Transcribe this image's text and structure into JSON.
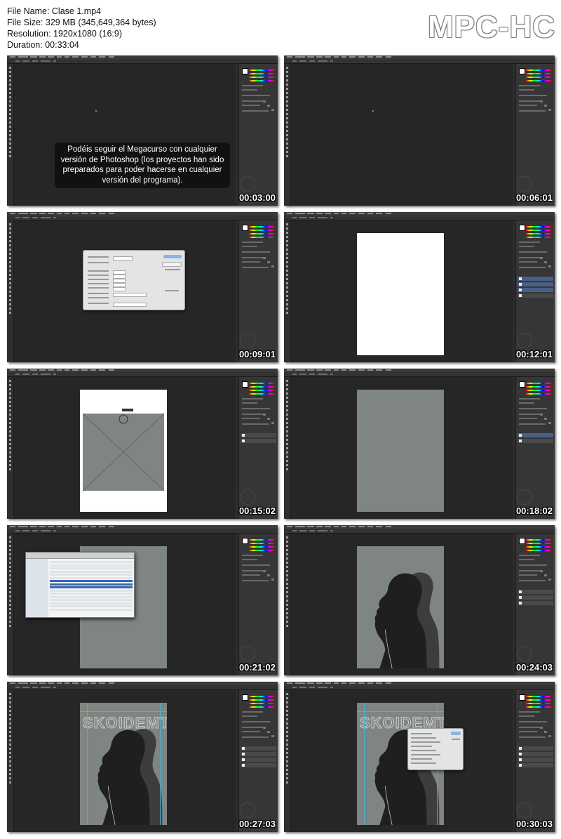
{
  "file_info": {
    "file_name": "File Name: Clase 1.mp4",
    "file_size": "File Size: 329 MB (345,649,364 bytes)",
    "resolution": "Resolution: 1920x1080 (16:9)",
    "duration": "Duration: 00:33:04"
  },
  "brand": "MPC-HC",
  "thumbnails": [
    {
      "timecode": "00:03:00",
      "scene": "empty-with-caption"
    },
    {
      "timecode": "00:06:01",
      "scene": "empty"
    },
    {
      "timecode": "00:09:01",
      "scene": "new-document-dialog"
    },
    {
      "timecode": "00:12:01",
      "scene": "white-canvas"
    },
    {
      "timecode": "00:15:02",
      "scene": "placed-image"
    },
    {
      "timecode": "00:18:02",
      "scene": "gray-canvas"
    },
    {
      "timecode": "00:21:02",
      "scene": "file-browser"
    },
    {
      "timecode": "00:24:03",
      "scene": "silhouettes"
    },
    {
      "timecode": "00:27:03",
      "scene": "silhouettes-with-title"
    },
    {
      "timecode": "00:30:03",
      "scene": "silhouettes-with-dialog"
    }
  ],
  "caption": {
    "line1": "Podéis seguir el Megacurso con cualquier",
    "line2": "versión de Photoshop (los proyectos han sido",
    "line3": "preparados para poder hacerse en cualquier",
    "line4": "versión del programa)."
  },
  "poster_title": "SKOIDEMTO",
  "colors": {
    "workspace": "#262626",
    "panel": "#363636",
    "canvas_gray": "#7e8582",
    "selection_blue": "#4a5f86",
    "guide": "#3fb6d6"
  }
}
